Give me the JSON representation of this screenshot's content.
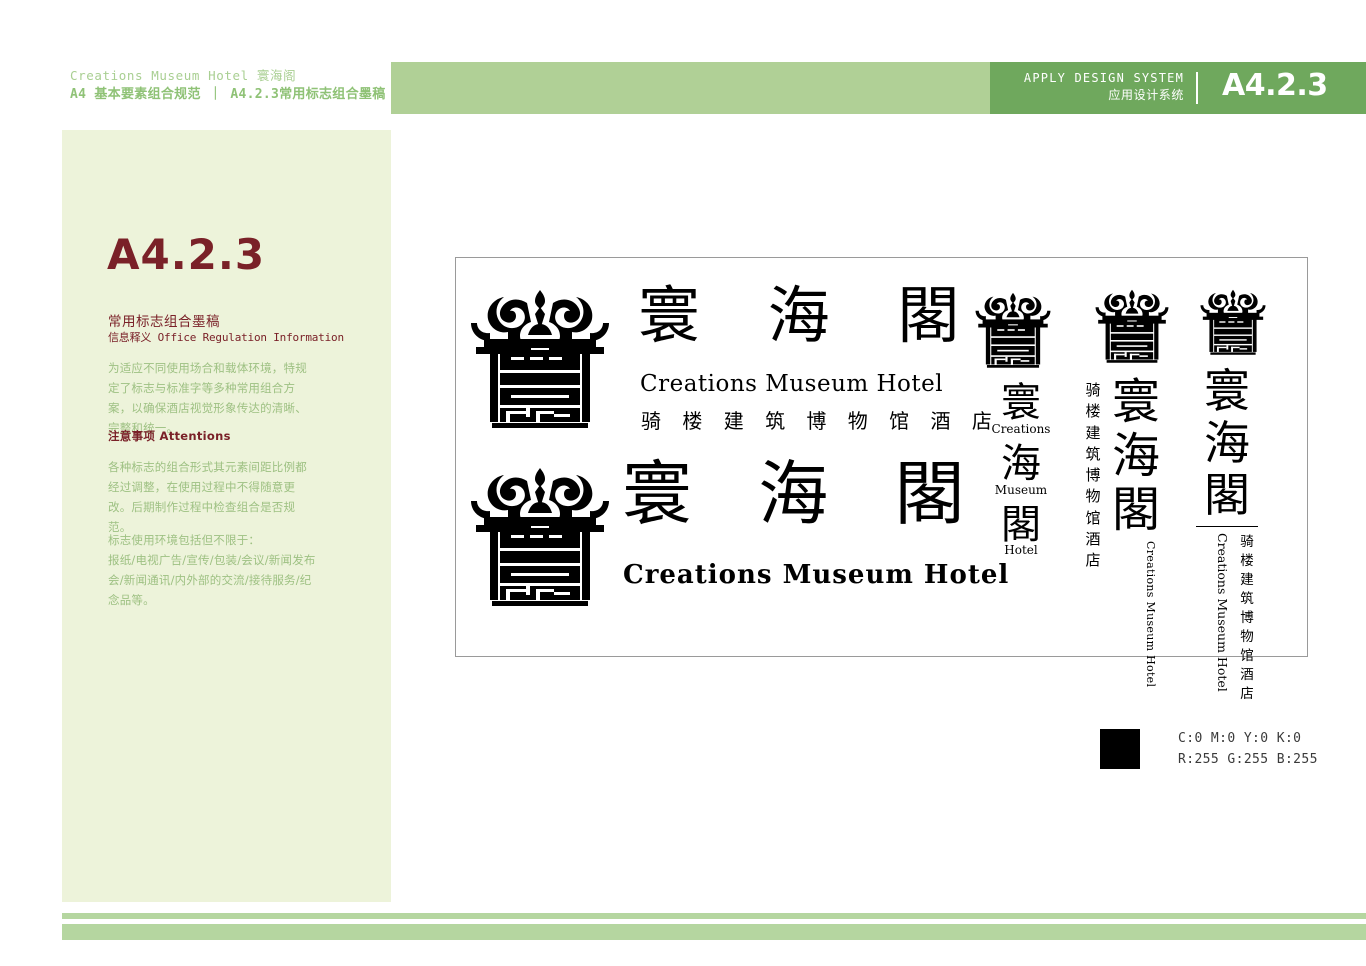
{
  "header": {
    "brand_line": "Creations Museum Hotel 寰海阁",
    "section_line": "A4 基本要素组合规范 ｜ A4.2.3常用标志组合墨稿",
    "apply_en": "APPLY DESIGN SYSTEM",
    "apply_cn": "应用设计系统",
    "code": "A4.2.3"
  },
  "sidebar": {
    "code": "A4.2.3",
    "title_cn": "常用标志组合墨稿",
    "title_sub": "信息释义 Office Regulation Information",
    "intro": "为适应不同使用场合和载体环境，特规定了标志与标准字等多种常用组合方案，以确保酒店视觉形象传达的清晰、完整和统一。",
    "attentions_label": "注意事项 Attentions",
    "attention_1": "各种标志的组合形式其元素间距比例都经过调整，在使用过程中不得随意更改。后期制作过程中检查组合是否规范。",
    "attention_2_head": "标志使用环境包括但不限于：",
    "attention_2_body": "报纸/电视广告/宣传/包装/会议/新闻发布会/新闻通讯/内外部的交流/接待服务/纪念品等。"
  },
  "logos": {
    "cjk_full": "寰 海 閣",
    "cjk_full_b": "寰 海 閣",
    "en_full": "Creations  Museum  Hotel",
    "en_full_bold": "Creations  Museum  Hotel",
    "cn_full": "骑 楼 建 筑 博 物 馆 酒 店",
    "stack": [
      {
        "cjk": "寰",
        "en": "Creations"
      },
      {
        "cjk": "海",
        "en": "Museum"
      },
      {
        "cjk": "閣",
        "en": "Hotel"
      }
    ],
    "vertical_cjk": "寰\n海\n閣",
    "vertical_cn": "骑楼建筑博物馆酒店",
    "vertical_en": "Creations Museum Hotel"
  },
  "swatch": {
    "cmyk": "C:0 M:0 Y:0 K:0",
    "rgb": "R:255 G:255 B:255",
    "color": "#000000"
  },
  "colors": {
    "header_light": "#b0d096",
    "header_dark": "#6fa85d",
    "sidebar_bg": "#edf3da",
    "accent_red": "#7a2128",
    "footer_green": "#b5d6a0"
  }
}
